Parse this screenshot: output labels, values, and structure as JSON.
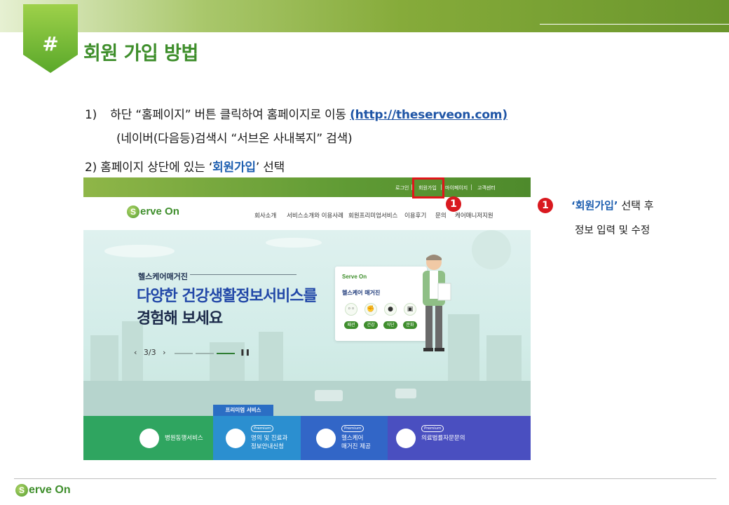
{
  "slide": {
    "badge": "#",
    "title": "회원 가입 방법"
  },
  "instructions": {
    "line1_num": "1)",
    "line1_text": "하단 “홈페이지” 버튼 클릭하여  홈페이지로 이동",
    "line1_link": "(http://theserveon.com)",
    "line2_text": "(네이버(다음등)검색시  “서브온 사내복지” 검색)",
    "line3_num": "2)",
    "line3_pre": "홈페이지 상단에 있는 ‘",
    "line3_em": "회원가입",
    "line3_post": "’ 선택"
  },
  "website": {
    "top_links": [
      "로그인",
      "회원가입",
      "마이페이지",
      "고객센터"
    ],
    "logo_s": "S",
    "logo_text": "erve On",
    "nav": [
      "회사소개",
      "서비스소개와 이용사례",
      "회원프리미엄서비스",
      "이용후기",
      "문의",
      "케어매니저지원"
    ],
    "hero_sub": "헬스케어매거진",
    "hero_line1": "다양한 건강생활정보서비스를",
    "hero_line2": "경험해 보세요",
    "pager": "3/3",
    "card_logo": "Serve On",
    "card_title": "헬스케어 매거진",
    "card_tags": [
      "패션",
      "건강",
      "식단",
      "문화"
    ],
    "premium_tab": "프리미엄 서비스",
    "premium_label": "Premium",
    "services": [
      {
        "line1": "병원동행서비스",
        "line2": ""
      },
      {
        "line1": "명의 및 진료과",
        "line2": "정보안내신청"
      },
      {
        "line1": "헬스케어",
        "line2": "매거진 제공"
      },
      {
        "line1": "의료법률자문문의",
        "line2": ""
      }
    ],
    "service_colors": [
      "#2fa560",
      "#2b8fd0",
      "#3266c7",
      "#4a4fc0"
    ]
  },
  "marker_label": "1",
  "note": {
    "open_quote": "‘",
    "em": "회원가입",
    "close_quote": "’",
    "rest": " 선택 후",
    "line2": "정보 입력 및 수정"
  },
  "footer": {
    "logo_s": "S",
    "logo_text": "erve On"
  },
  "colors": {
    "brand_green": "#3e8e2b",
    "link_blue": "#1f55a6",
    "marker_red": "#d9191f"
  }
}
